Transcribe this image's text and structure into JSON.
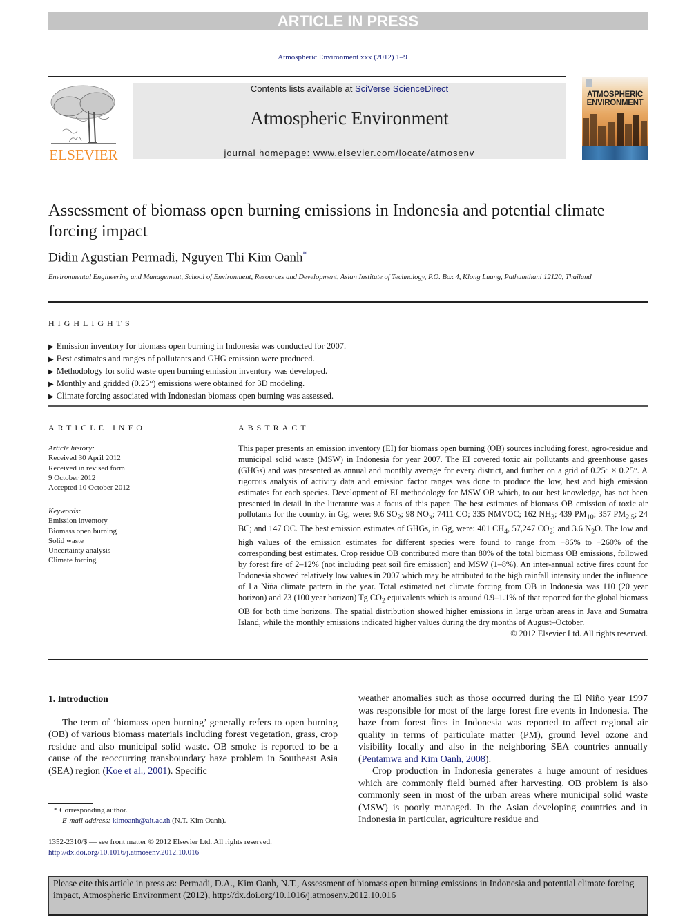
{
  "banner": {
    "label": "ARTICLE IN PRESS"
  },
  "journal_ref": "Atmospheric Environment xxx (2012) 1–9",
  "header": {
    "contents_prefix": "Contents lists available at ",
    "contents_link": "SciVerse ScienceDirect",
    "journal_title": "Atmospheric Environment",
    "homepage": "journal homepage: www.elsevier.com/locate/atmosenv",
    "publisher_logo_text": "ELSEVIER",
    "cover_title_line1": "ATMOSPHERIC",
    "cover_title_line2": "ENVIRONMENT"
  },
  "colors": {
    "link": "#1a237e",
    "publisher_orange": "#f28c28",
    "banner_gray": "#c4c4c4"
  },
  "article": {
    "title": "Assessment of biomass open burning emissions in Indonesia and potential climate forcing impact",
    "authors": "Didin Agustian Permadi, Nguyen Thi Kim Oanh",
    "author_mark": "*",
    "affiliation": "Environmental Engineering and Management, School of Environment, Resources and Development, Asian Institute of Technology, P.O. Box 4, Klong Luang, Pathumthani 12120, Thailand"
  },
  "highlights": {
    "label": "HIGHLIGHTS",
    "bullet": "▶",
    "items": [
      "Emission inventory for biomass open burning in Indonesia was conducted for 2007.",
      "Best estimates and ranges of pollutants and GHG emission were produced.",
      "Methodology for solid waste open burning emission inventory was developed.",
      "Monthly and gridded (0.25°) emissions were obtained for 3D modeling.",
      "Climate forcing associated with Indonesian biomass open burning was assessed."
    ]
  },
  "article_info": {
    "label": "ARTICLE INFO",
    "history_label": "Article history:",
    "history": [
      "Received 30 April 2012",
      "Received in revised form",
      "9 October 2012",
      "Accepted 10 October 2012"
    ],
    "keywords_label": "Keywords:",
    "keywords": [
      "Emission inventory",
      "Biomass open burning",
      "Solid waste",
      "Uncertainty analysis",
      "Climate forcing"
    ]
  },
  "abstract": {
    "label": "ABSTRACT",
    "p1": "This paper presents an emission inventory (EI) for biomass open burning (OB) sources including forest, agro-residue and municipal solid waste (MSW) in Indonesia for year 2007. The EI covered toxic air pollutants and greenhouse gases (GHGs) and was presented as annual and monthly average for every district, and further on a grid of 0.25° × 0.25°. A rigorous analysis of activity data and emission factor ranges was done to produce the low, best and high emission estimates for each species. Development of EI methodology for MSW OB which, to our best knowledge, has not been presented in detail in the literature was a focus of this paper. The best estimates of biomass OB emission of toxic air pollutants for the country, in Gg, were: 9.6 SO",
    "s1": "2",
    "p2": "; 98 NO",
    "s2": "x",
    "p3": "; 7411 CO; 335 NMVOC; 162 NH",
    "s3": "3",
    "p4": "; 439 PM",
    "s4": "10",
    "p5": "; 357 PM",
    "s5": "2.5",
    "p6": "; 24 BC; and 147 OC. The best emission estimates of GHGs, in Gg, were: 401 CH",
    "s6": "4",
    "p7": ", 57,247 CO",
    "s7": "2",
    "p8": "; and 3.6 N",
    "s8": "2",
    "p9": "O. The low and high values of the emission estimates for different species were found to range from −86% to +260% of the corresponding best estimates. Crop residue OB contributed more than 80% of the total biomass OB emissions, followed by forest fire of 2‒12% (not including peat soil fire emission) and MSW (1–8%). An inter-annual active fires count for Indonesia showed relatively low values in 2007 which may be attributed to the high rainfall intensity under the influence of La Niña climate pattern in the year. Total estimated net climate forcing from OB in Indonesia was 110 (20 year horizon) and 73 (100 year horizon) Tg CO",
    "s9": "2",
    "p10": " equivalents which is around 0.9–1.1% of that reported for the global biomass OB for both time horizons. The spatial distribution showed higher emissions in large urban areas in Java and Sumatra Island, while the monthly emissions indicated higher values during the dry months of August–October.",
    "copyright": "© 2012 Elsevier Ltd. All rights reserved."
  },
  "body": {
    "intro_heading": "1.  Introduction",
    "left_p1a": "The term of ‘biomass open burning’ generally refers to open burning (OB) of various biomass materials including forest vegetation, grass, crop residue and also municipal solid waste. OB smoke is reported to be a cause of the reoccurring transboundary haze problem in Southeast Asia (SEA) region (",
    "left_ref1": "Koe et al., 2001",
    "left_p1b": "). Specific",
    "right_p1a": "weather anomalies such as those occurred during the El Niño year 1997 was responsible for most of the large forest fire events in Indonesia. The haze from forest fires in Indonesia was reported to affect regional air quality in terms of particulate matter (PM), ground level ozone and visibility locally and also in the neighboring SEA countries annually (",
    "right_ref1": "Pentamwa and Kim Oanh, 2008",
    "right_p1b": ").",
    "right_p2": "Crop production in Indonesia generates a huge amount of residues which are commonly field burned after harvesting. OB problem is also commonly seen in most of the urban areas where municipal solid waste (MSW) is poorly managed. In the Asian developing countries and in Indonesia in particular, agriculture residue and"
  },
  "footnotes": {
    "corresponding": "*  Corresponding author.",
    "email_label": "E-mail address: ",
    "email": "kimoanh@ait.ac.th",
    "email_suffix": " (N.T. Kim Oanh).",
    "front_matter": "1352-2310/$ — see front matter © 2012 Elsevier Ltd. All rights reserved.",
    "doi": "http://dx.doi.org/10.1016/j.atmosenv.2012.10.016"
  },
  "citation_box": {
    "text": "Please cite this article in press as: Permadi, D.A., Kim Oanh, N.T., Assessment of biomass open burning emissions in Indonesia and potential climate forcing impact, Atmospheric Environment (2012), http://dx.doi.org/10.1016/j.atmosenv.2012.10.016"
  }
}
